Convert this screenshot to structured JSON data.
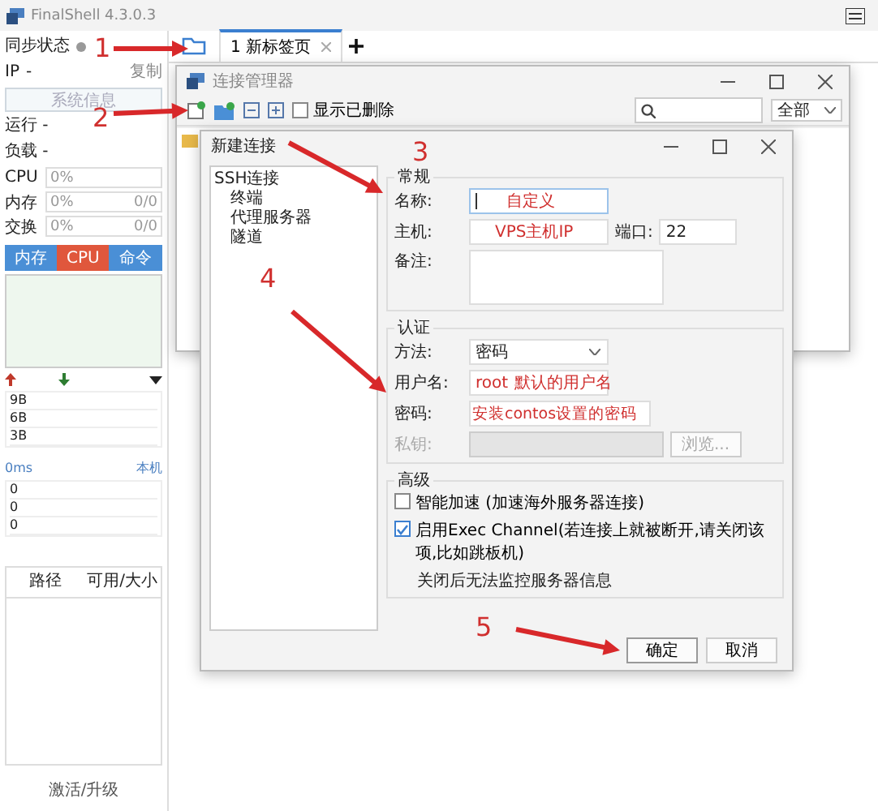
{
  "window": {
    "title": "FinalShell 4.3.0.3"
  },
  "sidebar": {
    "sync_label": "同步状态",
    "ip_label": "IP",
    "ip_value": "-",
    "copy": "复制",
    "sysinfo_button": "系统信息",
    "stats": [
      "运行 -",
      "负载 -"
    ],
    "meters": [
      {
        "label": "CPU",
        "reading": "0%",
        "level": 0
      },
      {
        "label": "内存",
        "reading": "0%",
        "extra": "0/0",
        "level": 0
      },
      {
        "label": "交换",
        "reading": "0%",
        "extra": "0/0",
        "level": 0
      }
    ],
    "tabs": [
      {
        "label": "内存",
        "selected": false
      },
      {
        "label": "CPU",
        "selected": true
      },
      {
        "label": "命令",
        "selected": false
      }
    ],
    "net_ticks": [
      "9B",
      "6B",
      "3B"
    ],
    "ping": "0ms",
    "host": "本机",
    "ping_ticks": [
      "0",
      "0",
      "0"
    ],
    "disk_columns": [
      "路径",
      "可用/大小"
    ],
    "activate": "激活/升级"
  },
  "tabs": [
    {
      "label": "1 新标签页",
      "selected": true
    }
  ],
  "connection_manager": {
    "title": "连接管理器",
    "show_deleted": {
      "label": "显示已删除",
      "checked": false
    },
    "filter": "全部"
  },
  "dialog": {
    "title": "新建连接",
    "tree": [
      {
        "label": "SSH连接",
        "children": [
          {
            "label": "终端"
          },
          {
            "label": "代理服务器"
          },
          {
            "label": "隧道"
          }
        ]
      }
    ],
    "general": {
      "title": "常规",
      "name_label": "名称:",
      "name_note": "自定义",
      "host_label": "主机:",
      "host_note": "VPS主机IP",
      "port_label": "端口:",
      "port": "22",
      "remark_label": "备注:"
    },
    "auth": {
      "title": "认证",
      "method_label": "方法:",
      "method": "密码",
      "user_label": "用户名:",
      "user": "root",
      "user_note": "默认的用户名",
      "password_label": "密码:",
      "password_note": "安装contos设置的密码",
      "key_label": "私钥:",
      "browse": "浏览...",
      "key_disabled": true
    },
    "advanced": {
      "title": "高级",
      "options": [
        {
          "label": "智能加速 (加速海外服务器连接)",
          "checked": false
        },
        {
          "label": "启用Exec Channel(若连接上就被断开,请关闭该项,比如跳板机)",
          "checked": true
        }
      ],
      "note": "关闭后无法监控服务器信息"
    },
    "buttons": [
      "确定",
      "取消"
    ]
  },
  "annotations": [
    {
      "label": "1"
    },
    {
      "label": "2"
    },
    {
      "label": "3"
    },
    {
      "label": "4"
    },
    {
      "label": "5"
    }
  ]
}
